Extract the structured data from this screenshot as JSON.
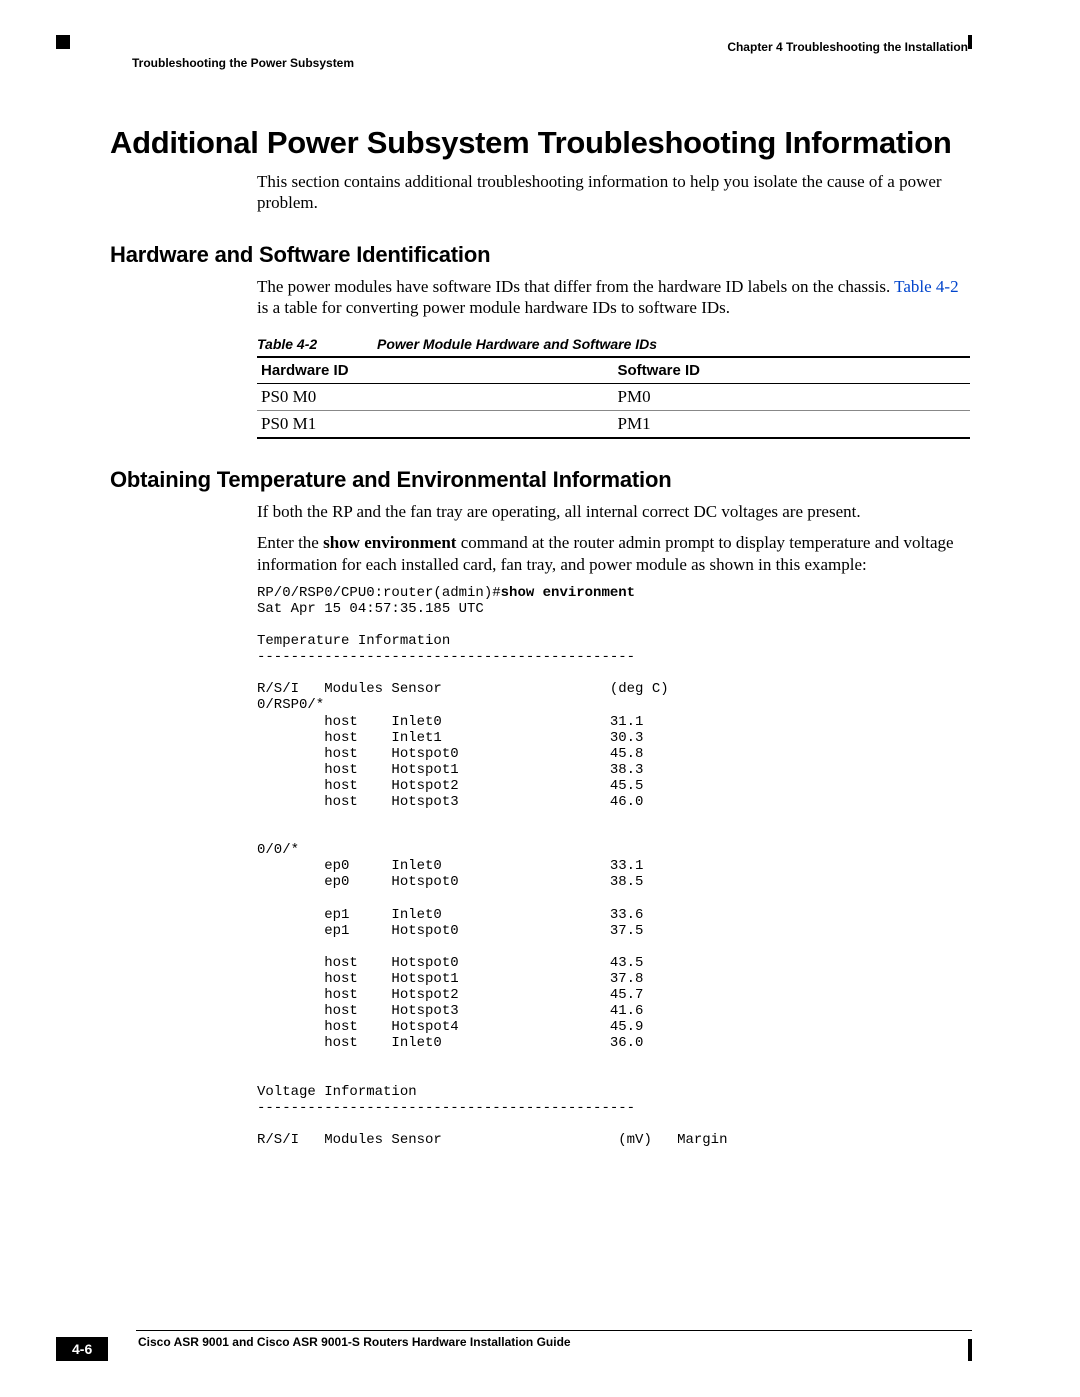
{
  "header": {
    "chapter": "Chapter 4      Troubleshooting the Installation",
    "section": "Troubleshooting the Power Subsystem"
  },
  "h1": "Additional Power Subsystem Troubleshooting Information",
  "intro": "This section contains additional troubleshooting information to help you isolate the cause of a power problem.",
  "h2a": "Hardware and Software Identification",
  "p2a_1": "The power modules have software IDs that differ from the hardware ID labels on the chassis. ",
  "xref": "Table 4-2",
  "p2a_2": " is a table for converting power module hardware IDs to software IDs.",
  "table_caption_num": "Table 4-2",
  "table_caption_title": "Power Module Hardware and Software IDs",
  "table": {
    "head": {
      "a": "Hardware ID",
      "b": "Software ID"
    },
    "rows": [
      {
        "a": "PS0 M0",
        "b": "PM0"
      },
      {
        "a": "PS0 M1",
        "b": "PM1"
      }
    ]
  },
  "h2b": "Obtaining Temperature and Environmental Information",
  "p2b_1": "If both the RP and the fan tray are operating, all internal correct DC voltages are present.",
  "p2b_2a": "Enter the ",
  "p2b_2cmd": "show environment",
  "p2b_2b": " command at the router admin prompt to display temperature and voltage information for each installed card, fan tray, and power module as shown in this example:",
  "cli": {
    "prompt": "RP/0/RSP0/CPU0:router(admin)#",
    "command": "show environment",
    "timestamp": "Sat Apr 15 04:57:35.185 UTC",
    "temp_title": "Temperature Information",
    "rule": "---------------------------------------------",
    "temp_header": "R/S/I   Modules Sensor                    (deg C)",
    "slot0": "0/RSP0/*",
    "t0": [
      "        host    Inlet0                    31.1",
      "        host    Inlet1                    30.3",
      "        host    Hotspot0                  45.8",
      "        host    Hotspot1                  38.3",
      "        host    Hotspot2                  45.5",
      "        host    Hotspot3                  46.0"
    ],
    "slot1": "0/0/*",
    "t1a": [
      "        ep0     Inlet0                    33.1",
      "        ep0     Hotspot0                  38.5"
    ],
    "t1b": [
      "        ep1     Inlet0                    33.6",
      "        ep1     Hotspot0                  37.5"
    ],
    "t1c": [
      "        host    Hotspot0                  43.5",
      "        host    Hotspot1                  37.8",
      "        host    Hotspot2                  45.7",
      "        host    Hotspot3                  41.6",
      "        host    Hotspot4                  45.9",
      "        host    Inlet0                    36.0"
    ],
    "volt_title": "Voltage Information",
    "volt_header": "R/S/I   Modules Sensor                     (mV)   Margin"
  },
  "footer": {
    "book": "Cisco ASR 9001 and Cisco ASR 9001-S Routers Hardware Installation Guide",
    "page": "4-6"
  }
}
